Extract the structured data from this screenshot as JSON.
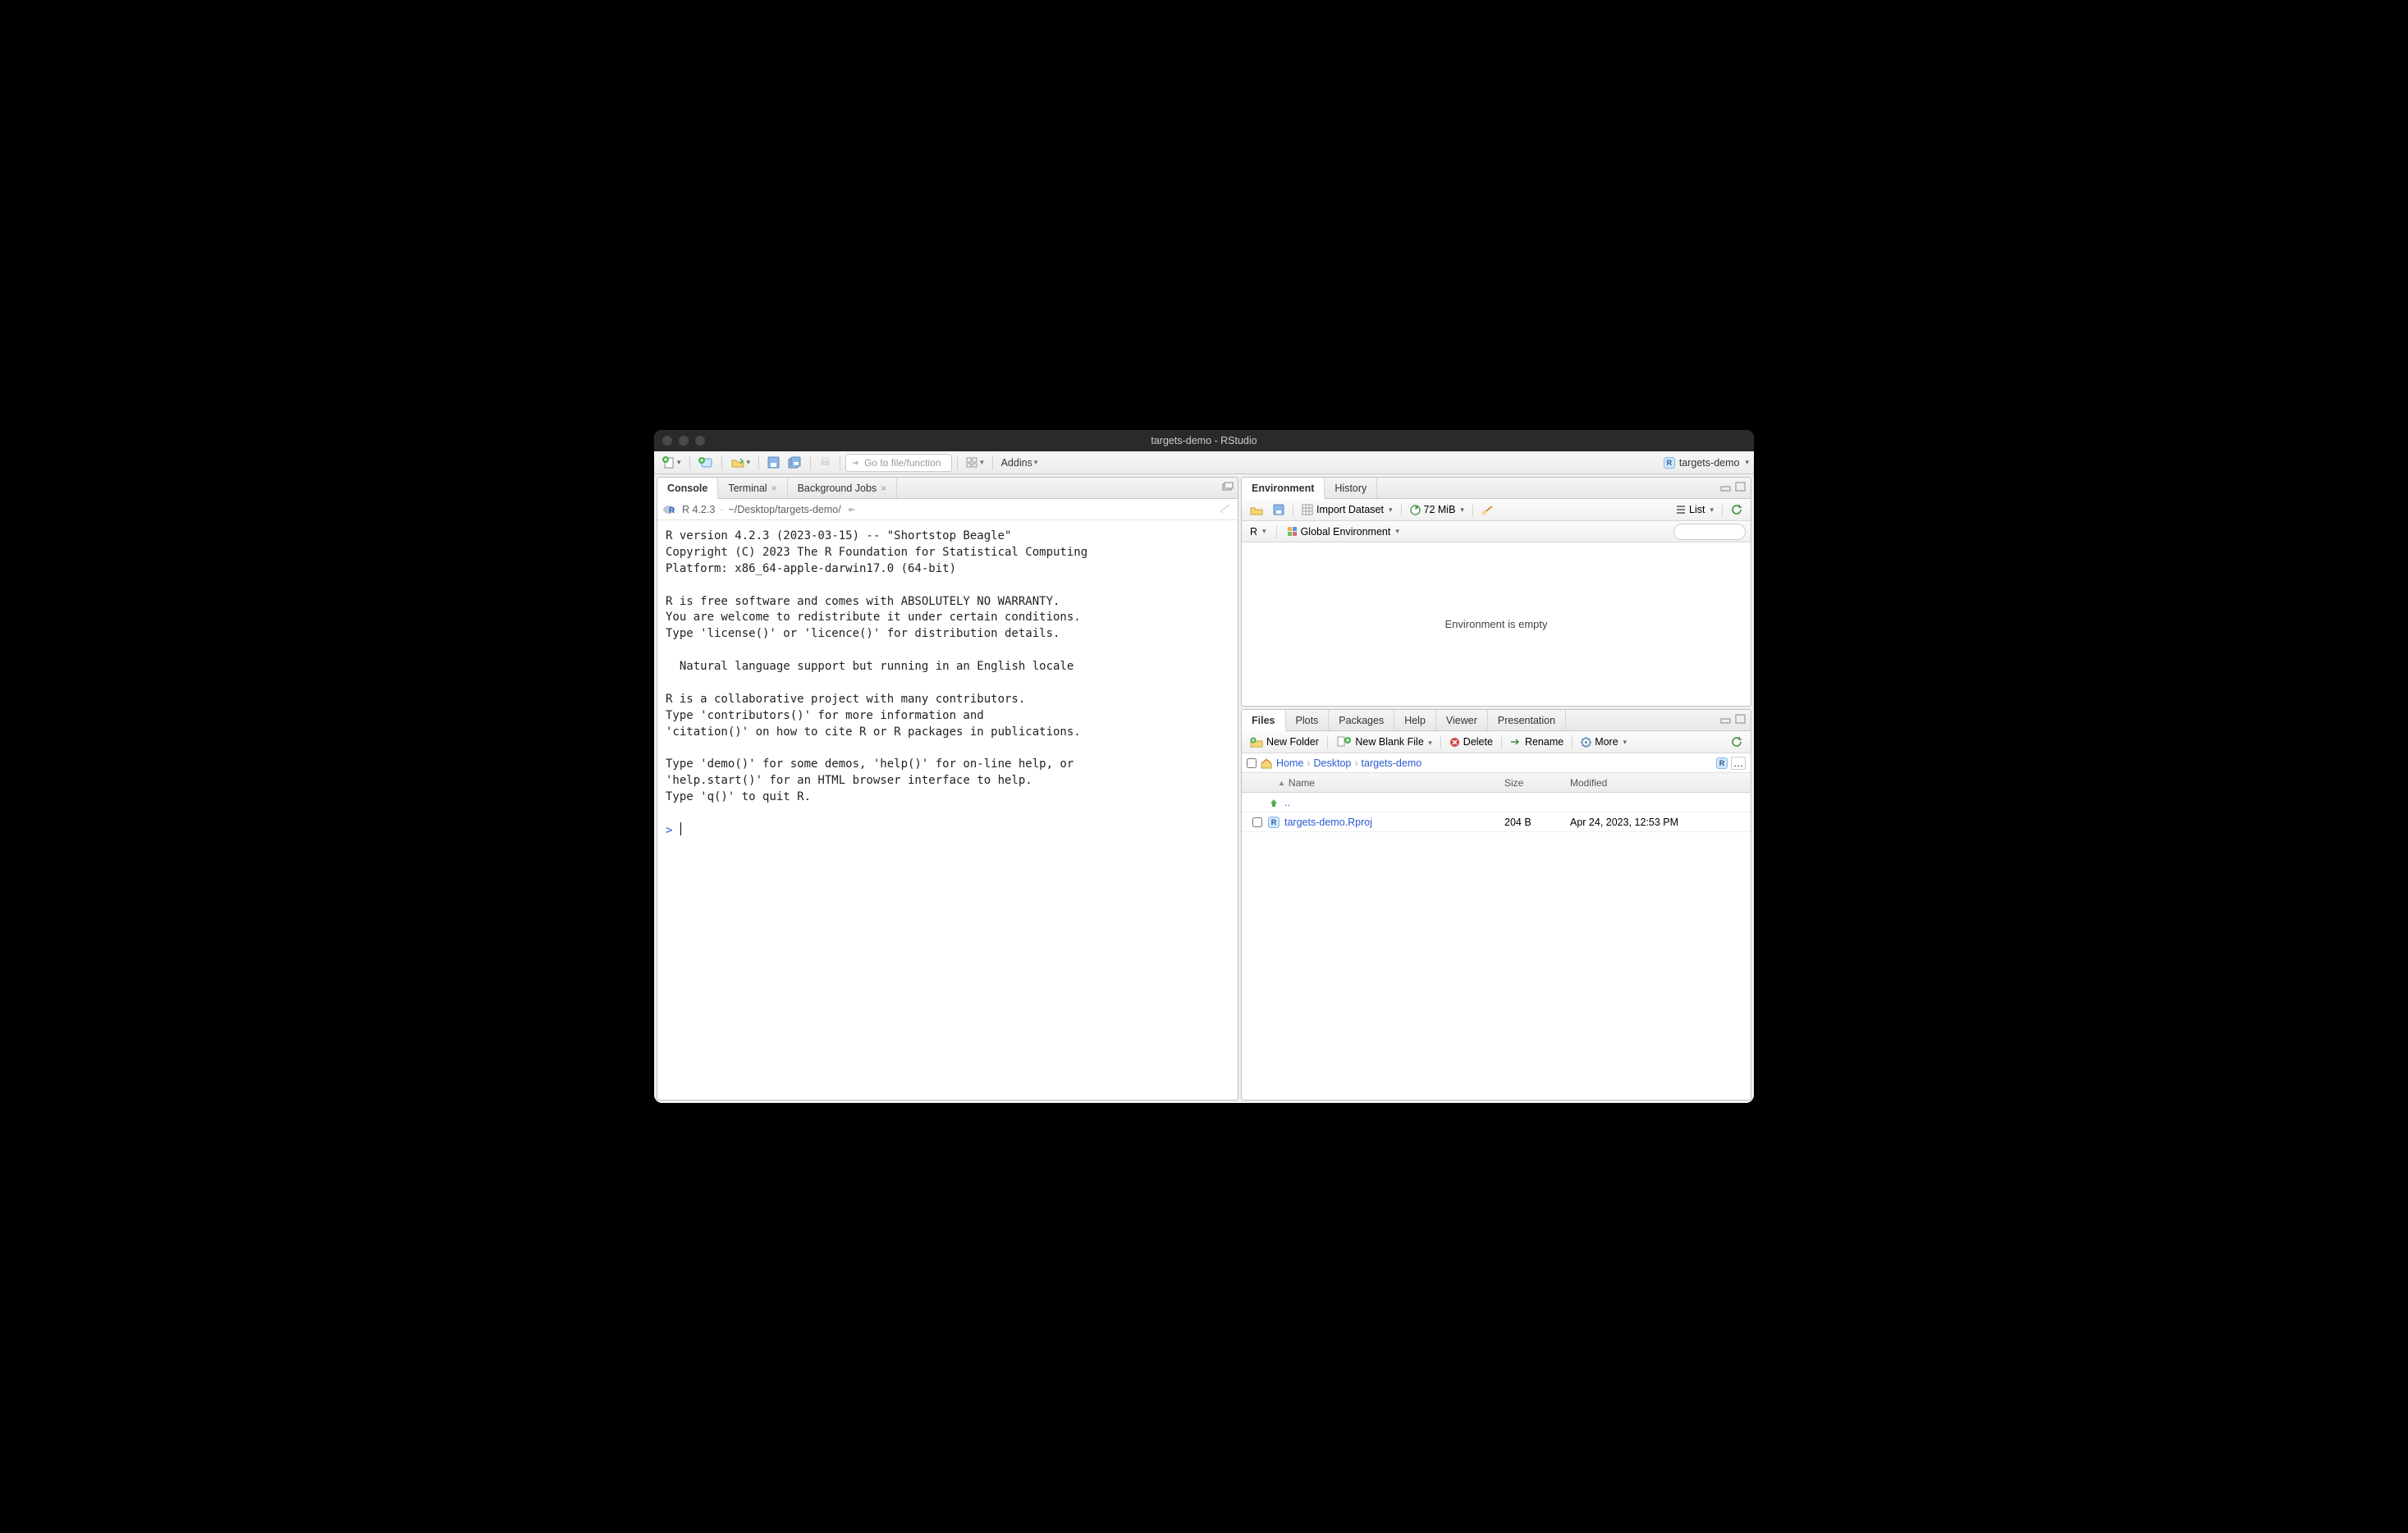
{
  "window": {
    "title": "targets-demo - RStudio"
  },
  "project": {
    "name": "targets-demo"
  },
  "maintoolbar": {
    "goto_placeholder": "Go to file/function",
    "addins": "Addins"
  },
  "left": {
    "tabs": {
      "console": "Console",
      "terminal": "Terminal",
      "bgjobs": "Background Jobs"
    },
    "header": {
      "rversion": "R 4.2.3",
      "path": "~/Desktop/targets-demo/"
    },
    "console_text": "R version 4.2.3 (2023-03-15) -- \"Shortstop Beagle\"\nCopyright (C) 2023 The R Foundation for Statistical Computing\nPlatform: x86_64-apple-darwin17.0 (64-bit)\n\nR is free software and comes with ABSOLUTELY NO WARRANTY.\nYou are welcome to redistribute it under certain conditions.\nType 'license()' or 'licence()' for distribution details.\n\n  Natural language support but running in an English locale\n\nR is a collaborative project with many contributors.\nType 'contributors()' for more information and\n'citation()' on how to cite R or R packages in publications.\n\nType 'demo()' for some demos, 'help()' for on-line help, or\n'help.start()' for an HTML browser interface to help.\nType 'q()' to quit R.\n",
    "prompt": ">"
  },
  "env": {
    "tabs": {
      "environment": "Environment",
      "history": "History"
    },
    "import": "Import Dataset",
    "mem": "72 MiB",
    "list": "List",
    "r": "R",
    "scope": "Global Environment",
    "empty": "Environment is empty"
  },
  "files": {
    "tabs": {
      "files": "Files",
      "plots": "Plots",
      "packages": "Packages",
      "help": "Help",
      "viewer": "Viewer",
      "presentation": "Presentation"
    },
    "newfolder": "New Folder",
    "newblank": "New Blank File",
    "delete": "Delete",
    "rename": "Rename",
    "more": "More",
    "crumbs": [
      "Home",
      "Desktop",
      "targets-demo"
    ],
    "cols": {
      "name": "Name",
      "size": "Size",
      "modified": "Modified"
    },
    "updir": "..",
    "rows": [
      {
        "name": "targets-demo.Rproj",
        "size": "204 B",
        "modified": "Apr 24, 2023, 12:53 PM"
      }
    ]
  }
}
